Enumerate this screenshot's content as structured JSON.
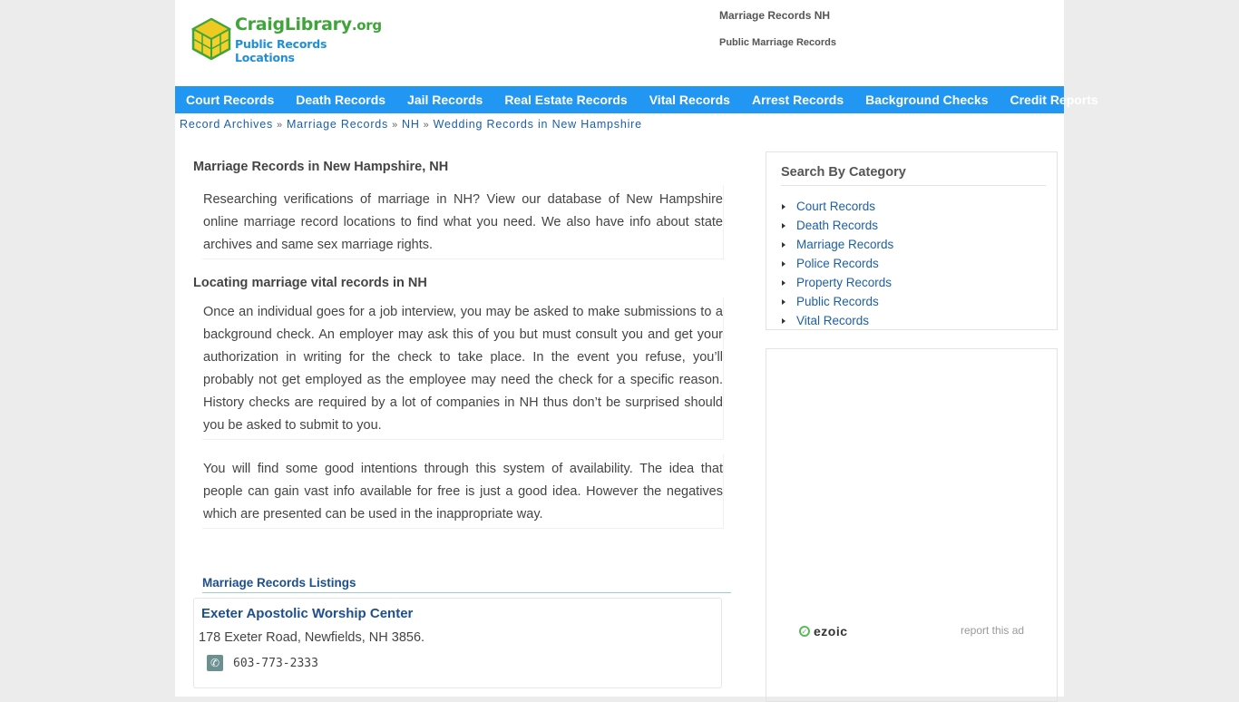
{
  "logo": {
    "name": "CraigLibrary",
    "tld": ".org",
    "tagline": "Public Records Locations"
  },
  "header_links": [
    "Marriage Records NH",
    "Public Marriage Records"
  ],
  "nav": [
    "Court Records",
    "Death Records",
    "Jail Records",
    "Real Estate Records",
    "Vital Records",
    "Arrest Records",
    "Background Checks",
    "Credit Reports"
  ],
  "breadcrumb": {
    "items": [
      "Record Archives",
      "Marriage Records",
      "NH",
      "Wedding Records in New Hampshire"
    ],
    "separator": "»"
  },
  "main": {
    "title": "Marriage Records in New Hampshire, NH",
    "intro": "Researching verifications of marriage in NH? View our database of New Hampshire online marriage record locations to find what you need. We also have info about state archives and same sex marriage rights.",
    "subheading": "Locating marriage vital records in NH",
    "paragraph1": "Once an individual goes for a job interview, you may be asked to make submissions to a background check. An employer may ask this of you but must consult you and get your authorization in writing for the check to take place. In the event you refuse, you’ll probably not get employed as the employee may need the check for a specific reason. History checks are required by a lot of companies in NH thus don’t be surprised should you be asked to submit to you.",
    "paragraph2": "You will find some good intentions through this system of availability. The idea that people can gain vast info available for free is just a good idea. However the negatives which are presented can be used in the inappropriate way.",
    "listings_heading": "Marriage Records Listings",
    "listing": {
      "name": "Exeter Apostolic Worship Center",
      "address": "178 Exeter Road, Newfields, NH 3856.",
      "phone": "603-773-2333"
    }
  },
  "sidebar": {
    "title": "Search By Category",
    "categories": [
      "Court Records",
      "Death Records",
      "Marriage Records",
      "Police Records",
      "Property Records",
      "Public Records",
      "Vital Records"
    ]
  },
  "ad": {
    "brand": "ezoic",
    "report": "report this ad"
  },
  "colors": {
    "nav_bg": "#2196f3",
    "link": "#1d5fa6",
    "logo_green": "#3fa43a",
    "logo_blue": "#1f8fd6"
  }
}
